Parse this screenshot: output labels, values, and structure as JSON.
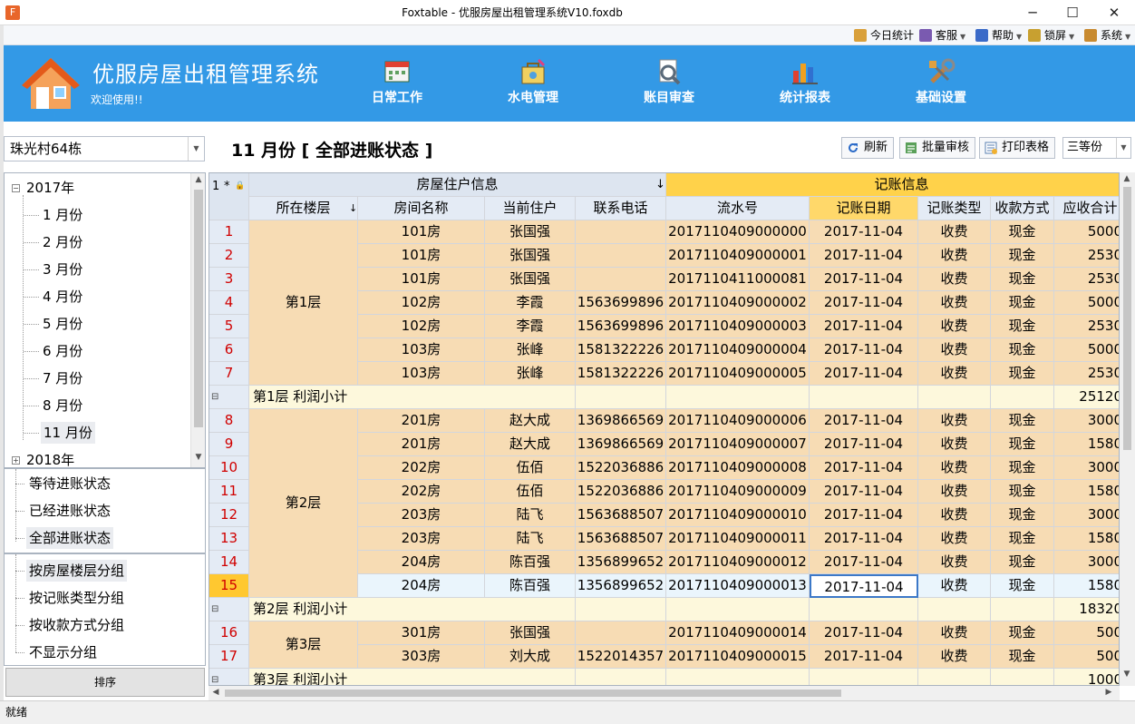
{
  "window": {
    "title": "Foxtable - 优服房屋出租管理系统V10.foxdb",
    "app_icon": "F",
    "minimize": "─",
    "maximize": "☐",
    "close": "✕"
  },
  "menubar": {
    "items": [
      {
        "label": "今日统计",
        "icon": "calendar-icon",
        "has_arrow": false
      },
      {
        "label": "客服",
        "icon": "users-icon",
        "has_arrow": true
      },
      {
        "label": "帮助",
        "icon": "help-icon",
        "has_arrow": true
      },
      {
        "label": "锁屏",
        "icon": "lock-icon",
        "has_arrow": true
      },
      {
        "label": "系统",
        "icon": "system-icon",
        "has_arrow": true
      }
    ],
    "arrow": "▼"
  },
  "banner": {
    "app_title": "优服房屋出租管理系统",
    "welcome": "欢迎使用!!",
    "nav": [
      {
        "label": "日常工作",
        "icon": "calendar-icon"
      },
      {
        "label": "水电管理",
        "icon": "utilities-icon"
      },
      {
        "label": "账目审查",
        "icon": "audit-icon"
      },
      {
        "label": "统计报表",
        "icon": "bar-chart-icon"
      },
      {
        "label": "基础设置",
        "icon": "tools-icon"
      }
    ]
  },
  "sidebar": {
    "building_select": "珠光村64栋",
    "dropdown_arrow": "▼",
    "tree": {
      "year_2017": "2017年",
      "months": [
        "1 月份",
        "2 月份",
        "3 月份",
        "4 月份",
        "5 月份",
        "6 月份",
        "7 月份",
        "8 月份",
        "11 月份"
      ],
      "year_2018": "2018年",
      "expanded_symbol": "−",
      "collapsed_symbol": "+"
    },
    "status_filters": [
      "等待进账状态",
      "已经进账状态",
      "全部进账状态"
    ],
    "active_status_filter": 2,
    "group_filters": [
      "按房屋楼层分组",
      "按记账类型分组",
      "按收款方式分组",
      "不显示分组"
    ],
    "active_group_filter": 0,
    "sort_button": "排序",
    "scroll_up": "▲",
    "scroll_down": "▼"
  },
  "toolbar": {
    "month_title": "11 月份 [ 全部进账状态 ]",
    "refresh": "刷新",
    "batch_review": "批量审核",
    "print_table": "打印表格",
    "scale": "三等份"
  },
  "grid": {
    "corner": [
      "1",
      "*",
      "🔒"
    ],
    "group_headers": {
      "house": "房屋住户信息",
      "account": "记账信息",
      "sort_arrow": "↓"
    },
    "columns": [
      "所在楼层",
      "房间名称",
      "当前住户",
      "联系电话",
      "流水号",
      "记账日期",
      "记账类型",
      "收款方式",
      "应收合计"
    ],
    "floor_sort_arrow": "↓",
    "floors": [
      {
        "label": "第1层",
        "rows": [
          {
            "n": "1",
            "room": "101房",
            "tenant": "张国强",
            "phone": "",
            "serial": "2017110409000000",
            "date": "2017-11-04",
            "type": "收费",
            "method": "现金",
            "due": "5000"
          },
          {
            "n": "2",
            "room": "101房",
            "tenant": "张国强",
            "phone": "",
            "serial": "2017110409000001",
            "date": "2017-11-04",
            "type": "收费",
            "method": "现金",
            "due": "2530"
          },
          {
            "n": "3",
            "room": "101房",
            "tenant": "张国强",
            "phone": "",
            "serial": "2017110411000081",
            "date": "2017-11-04",
            "type": "收费",
            "method": "现金",
            "due": "2530"
          },
          {
            "n": "4",
            "room": "102房",
            "tenant": "李霞",
            "phone": "1563699896",
            "serial": "2017110409000002",
            "date": "2017-11-04",
            "type": "收费",
            "method": "现金",
            "due": "5000"
          },
          {
            "n": "5",
            "room": "102房",
            "tenant": "李霞",
            "phone": "1563699896",
            "serial": "2017110409000003",
            "date": "2017-11-04",
            "type": "收费",
            "method": "现金",
            "due": "2530"
          },
          {
            "n": "6",
            "room": "103房",
            "tenant": "张峰",
            "phone": "1581322226",
            "serial": "2017110409000004",
            "date": "2017-11-04",
            "type": "收费",
            "method": "现金",
            "due": "5000"
          },
          {
            "n": "7",
            "room": "103房",
            "tenant": "张峰",
            "phone": "1581322226",
            "serial": "2017110409000005",
            "date": "2017-11-04",
            "type": "收费",
            "method": "现金",
            "due": "2530"
          }
        ],
        "subtotal_label": "第1层  利润小计",
        "subtotal": "25120"
      },
      {
        "label": "第2层",
        "rows": [
          {
            "n": "8",
            "room": "201房",
            "tenant": "赵大成",
            "phone": "1369866569",
            "serial": "2017110409000006",
            "date": "2017-11-04",
            "type": "收费",
            "method": "现金",
            "due": "3000"
          },
          {
            "n": "9",
            "room": "201房",
            "tenant": "赵大成",
            "phone": "1369866569",
            "serial": "2017110409000007",
            "date": "2017-11-04",
            "type": "收费",
            "method": "现金",
            "due": "1580"
          },
          {
            "n": "10",
            "room": "202房",
            "tenant": "伍佰",
            "phone": "1522036886",
            "serial": "2017110409000008",
            "date": "2017-11-04",
            "type": "收费",
            "method": "现金",
            "due": "3000"
          },
          {
            "n": "11",
            "room": "202房",
            "tenant": "伍佰",
            "phone": "1522036886",
            "serial": "2017110409000009",
            "date": "2017-11-04",
            "type": "收费",
            "method": "现金",
            "due": "1580"
          },
          {
            "n": "12",
            "room": "203房",
            "tenant": "陆飞",
            "phone": "1563688507",
            "serial": "2017110409000010",
            "date": "2017-11-04",
            "type": "收费",
            "method": "现金",
            "due": "3000"
          },
          {
            "n": "13",
            "room": "203房",
            "tenant": "陆飞",
            "phone": "1563688507",
            "serial": "2017110409000011",
            "date": "2017-11-04",
            "type": "收费",
            "method": "现金",
            "due": "1580"
          },
          {
            "n": "14",
            "room": "204房",
            "tenant": "陈百强",
            "phone": "1356899652",
            "serial": "2017110409000012",
            "date": "2017-11-04",
            "type": "收费",
            "method": "现金",
            "due": "3000"
          },
          {
            "n": "15",
            "room": "204房",
            "tenant": "陈百强",
            "phone": "1356899652",
            "serial": "2017110409000013",
            "date": "2017-11-04",
            "type": "收费",
            "method": "现金",
            "due": "1580"
          }
        ],
        "subtotal_label": "第2层  利润小计",
        "subtotal": "18320"
      },
      {
        "label": "第3层",
        "rows": [
          {
            "n": "16",
            "room": "301房",
            "tenant": "张国强",
            "phone": "",
            "serial": "2017110409000014",
            "date": "2017-11-04",
            "type": "收费",
            "method": "现金",
            "due": "500"
          },
          {
            "n": "17",
            "room": "303房",
            "tenant": "刘大成",
            "phone": "1522014357",
            "serial": "2017110409000015",
            "date": "2017-11-04",
            "type": "收费",
            "method": "现金",
            "due": "500"
          }
        ],
        "subtotal_label": "第3层  利润小计",
        "subtotal": "1000"
      }
    ],
    "selected_row": "15",
    "collapse_symbol": "⊟"
  },
  "status": {
    "text": "就绪"
  },
  "colors": {
    "banner": "#3399e6",
    "floor_cell": "#f7dcb4",
    "subtotal_row": "#fdf8dc",
    "account_header": "#ffd24a",
    "row_number": "#d00000"
  }
}
